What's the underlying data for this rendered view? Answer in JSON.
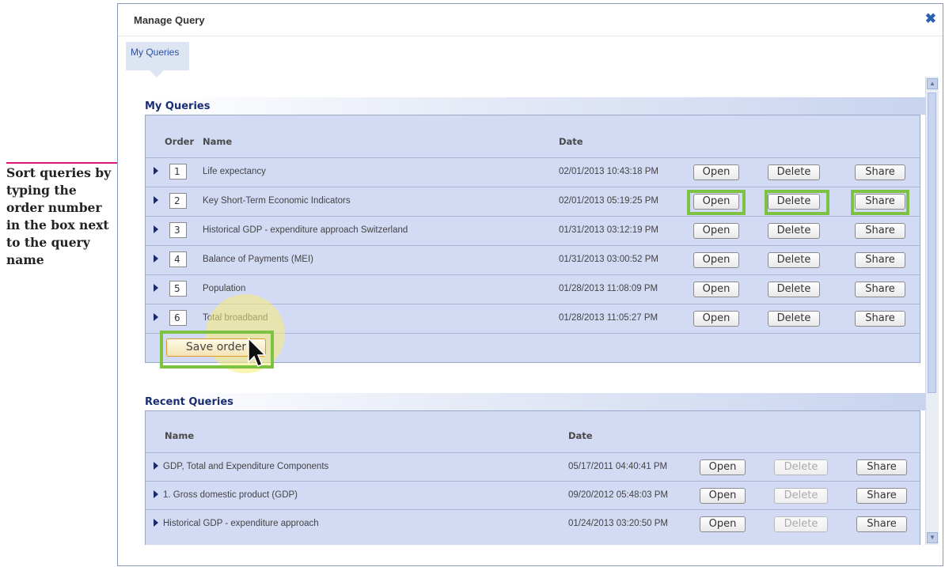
{
  "annotation": {
    "text": "Sort queries by typing the order number in the box next to the query name"
  },
  "dialog": {
    "title": "Manage Query",
    "close_icon": "close-icon",
    "tab_label": "My Queries"
  },
  "my_queries": {
    "heading": "My Queries",
    "columns": {
      "order": "Order",
      "name": "Name",
      "date": "Date"
    },
    "rows": [
      {
        "order": "1",
        "name": "Life expectancy",
        "date": "02/01/2013 10:43:18 PM"
      },
      {
        "order": "2",
        "name": "Key Short-Term Economic Indicators",
        "date": "02/01/2013 05:19:25 PM"
      },
      {
        "order": "3",
        "name": "Historical GDP - expenditure approach Switzerland",
        "date": "01/31/2013 03:12:19 PM"
      },
      {
        "order": "4",
        "name": "Balance of Payments (MEI)",
        "date": "01/31/2013 03:00:52 PM"
      },
      {
        "order": "5",
        "name": "Population",
        "date": "01/28/2013 11:08:09 PM"
      },
      {
        "order": "6",
        "name": "Total broadband",
        "date": "01/28/2013 11:05:27 PM"
      }
    ],
    "save_label": "Save order"
  },
  "recent_queries": {
    "heading": "Recent Queries",
    "columns": {
      "name": "Name",
      "date": "Date"
    },
    "rows": [
      {
        "name": "GDP, Total and Expenditure Components",
        "date": "05/17/2011 04:40:41 PM"
      },
      {
        "name": "1. Gross domestic product (GDP)",
        "date": "09/20/2012 05:48:03 PM"
      },
      {
        "name": "Historical GDP - expenditure approach",
        "date": "01/24/2013 03:20:50 PM"
      }
    ]
  },
  "buttons": {
    "open": "Open",
    "delete": "Delete",
    "share": "Share"
  },
  "colors": {
    "highlight": "#7dc242",
    "annotation": "#e0157a",
    "panel": "#d3daf3",
    "heading": "#1a2f73"
  }
}
